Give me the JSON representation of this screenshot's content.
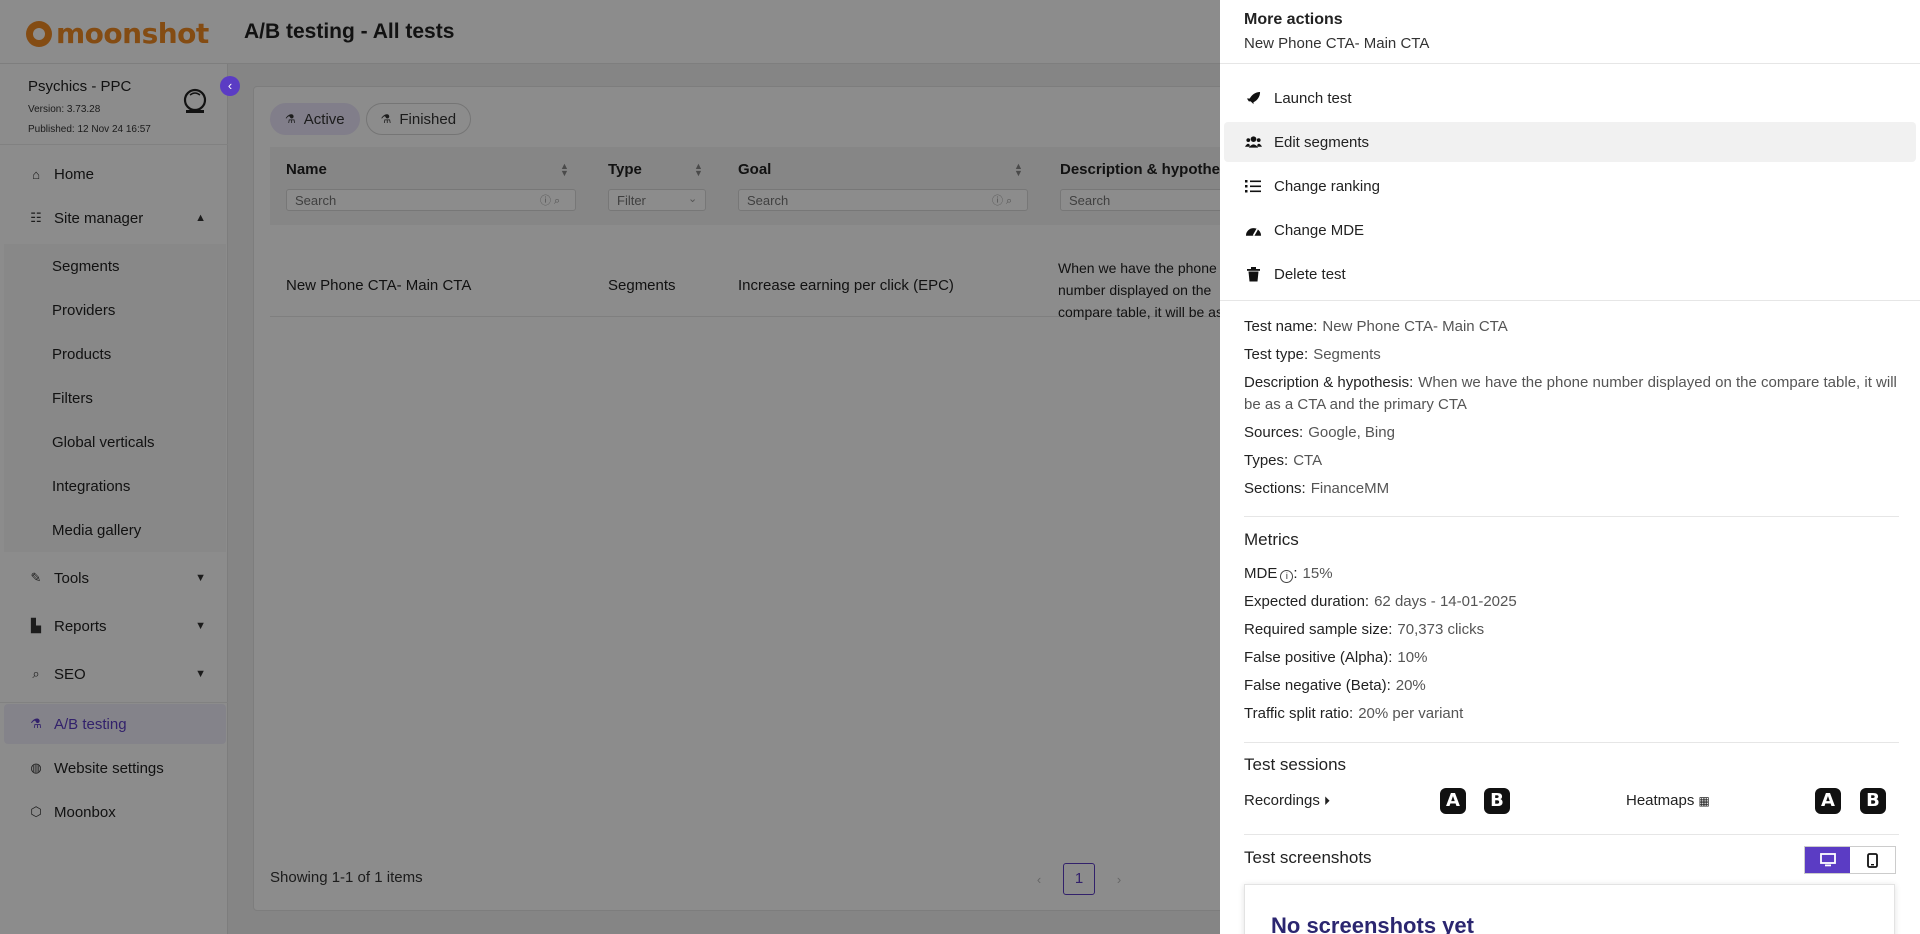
{
  "app": {
    "brand": "moonshot",
    "page_title": "A/B testing - All tests"
  },
  "site": {
    "name": "Psychics - PPC",
    "version": "Version: 3.73.28",
    "published": "Published: 12 Nov 24 16:57"
  },
  "nav": {
    "home": "Home",
    "site_manager": "Site manager",
    "sub": [
      "Segments",
      "Providers",
      "Products",
      "Filters",
      "Global verticals",
      "Integrations",
      "Media gallery"
    ],
    "tools": "Tools",
    "reports": "Reports",
    "seo": "SEO",
    "ab_testing": "A/B testing",
    "website_settings": "Website settings",
    "moonbox": "Moonbox"
  },
  "tabs": {
    "active": "Active",
    "finished": "Finished"
  },
  "table": {
    "columns": {
      "name": "Name",
      "type": "Type",
      "goal": "Goal",
      "description": "Description & hypothesis"
    },
    "placeholders": {
      "name": "Search",
      "type": "Filter",
      "goal": "Search",
      "description": "Search"
    },
    "rows": [
      {
        "name": "New Phone CTA- Main CTA",
        "type": "Segments",
        "goal": "Increase earning per click (EPC)",
        "description": "When we have the phone number displayed on the compare table, it will be as a CTA and the primary CTA"
      }
    ]
  },
  "footer": {
    "showing": "Showing 1-1 of 1 items",
    "page": "1"
  },
  "drawer": {
    "title": "More actions",
    "subtitle": "New Phone CTA- Main CTA",
    "menu": [
      {
        "label": "Launch test",
        "icon": "rocket-icon"
      },
      {
        "label": "Edit segments",
        "icon": "users-icon"
      },
      {
        "label": "Change ranking",
        "icon": "list-ordered-icon"
      },
      {
        "label": "Change MDE",
        "icon": "gauge-icon"
      },
      {
        "label": "Delete test",
        "icon": "trash-icon"
      }
    ],
    "details": {
      "test_name_label": "Test name:",
      "test_name": "New Phone CTA- Main CTA",
      "test_type_label": "Test type:",
      "test_type": "Segments",
      "description_label": "Description & hypothesis:",
      "description": "When we have the phone number displayed on the compare table, it will be as a CTA and the primary CTA",
      "sources_label": "Sources:",
      "sources": "Google, Bing",
      "types_label": "Types:",
      "types": "CTA",
      "sections_label": "Sections:",
      "sections": "FinanceMM"
    },
    "metrics": {
      "title": "Metrics",
      "mde_label": "MDE",
      "mde": "15%",
      "duration_label": "Expected duration:",
      "duration": "62 days - 14-01-2025",
      "sample_label": "Required sample size:",
      "sample": "70,373 clicks",
      "alpha_label": "False positive (Alpha):",
      "alpha": "10%",
      "beta_label": "False negative (Beta):",
      "beta": "20%",
      "split_label": "Traffic split ratio:",
      "split": "20% per variant"
    },
    "sessions": {
      "title": "Test sessions",
      "recordings": "Recordings",
      "heatmaps": "Heatmaps",
      "variant_a": "A",
      "variant_b": "B"
    },
    "screenshots": {
      "title": "Test screenshots",
      "empty": "No screenshots yet"
    }
  },
  "colors": {
    "accent": "#5b3cc4",
    "brand": "#f08a24"
  }
}
